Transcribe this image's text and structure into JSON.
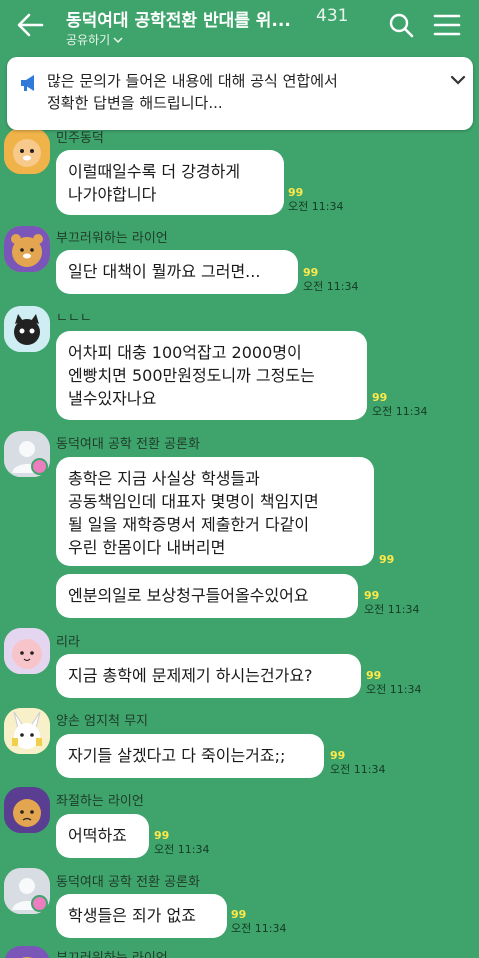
{
  "header": {
    "title": "동덕여대 공학전환 반대를 위...",
    "member_count": "431",
    "share_label": "공유하기"
  },
  "notice": {
    "text": "많은 문의가 들어온 내용에 대해 공식 연합에서\n정확한 답변을 해드립니다..."
  },
  "colors": {
    "background": "#3fa46c",
    "unread": "#ffe94a",
    "bubble": "#ffffff"
  },
  "messages": [
    {
      "nick": "민주동덕",
      "text": "이럴때일수록 더 강경하게\n나가야합니다",
      "unread": "99",
      "time": "오전 11:34",
      "avatar": "lion-cartoon"
    },
    {
      "nick": "부끄러워하는 라이언",
      "text": "일단 대책이 뭘까요 그러면...",
      "unread": "99",
      "time": "오전 11:34",
      "avatar": "ryan-shy"
    },
    {
      "nick": "ㄴㄴㄴ",
      "text": "어차피 대충 100억잡고 2000명이\n엔빵치면 500만원정도니까 그정도는\n낼수있자나요",
      "unread": "99",
      "time": "오전 11:34",
      "avatar": "black-cat"
    },
    {
      "nick": "동덕여대 공학 전환 공론화",
      "text": "총학은 지금 사실상 학생들과\n공동책임인데 대표자 몇명이 책임지면\n될 일을 재학증명서 제출한거 다같이\n우린 한몸이다 내버리면",
      "unread": "99",
      "time": "",
      "avatar": "default"
    },
    {
      "nick": "",
      "text": "엔분의일로 보상청구들어올수있어요",
      "unread": "99",
      "time": "오전 11:34",
      "avatar": ""
    },
    {
      "nick": "리라",
      "text": "지금 총학에 문제제기 하시는건가요?",
      "unread": "99",
      "time": "오전 11:34",
      "avatar": "apeach"
    },
    {
      "nick": "양손 엄지척 무지",
      "text": "자기들 살겠다고 다 죽이는거죠;;",
      "unread": "99",
      "time": "오전 11:34",
      "avatar": "muzi"
    },
    {
      "nick": "좌절하는 라이언",
      "text": "어떡하죠",
      "unread": "99",
      "time": "오전 11:34",
      "avatar": "ryan-sad"
    },
    {
      "nick": "동덕여대 공학 전환 공론화",
      "text": "학생들은 죄가 없죠",
      "unread": "99",
      "time": "오전 11:34",
      "avatar": "default"
    },
    {
      "nick": "부끄러워하는 라이언",
      "text": "",
      "unread": "",
      "time": "",
      "avatar": "ryan-shy"
    }
  ]
}
